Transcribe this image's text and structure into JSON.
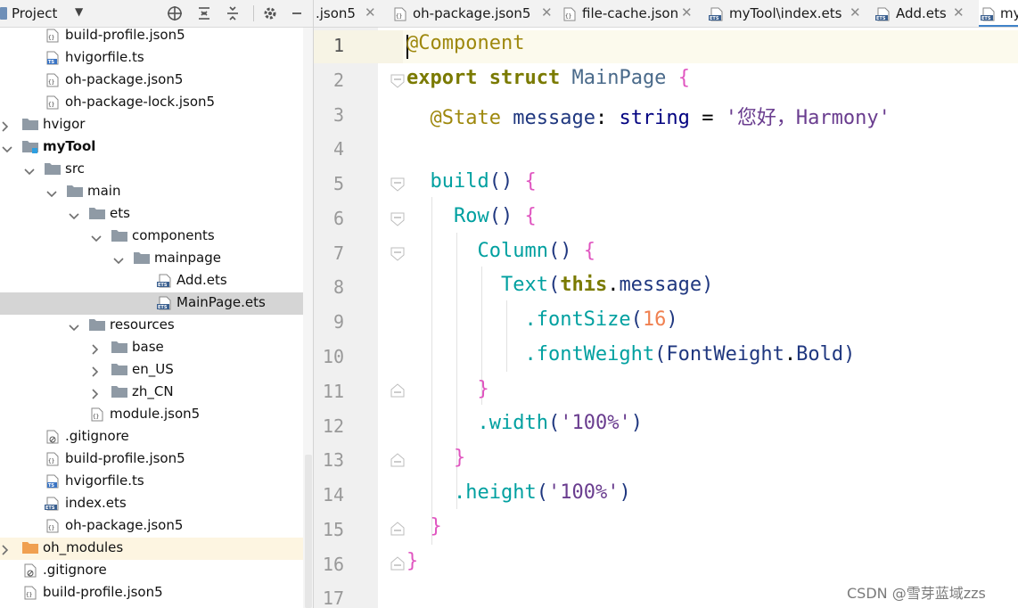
{
  "project_panel": {
    "title": "Project",
    "tree": [
      {
        "label": "build-profile.json5",
        "icon": "json-file-icon"
      },
      {
        "label": "hvigorfile.ts",
        "icon": "ts-file-icon"
      },
      {
        "label": "oh-package.json5",
        "icon": "json-file-icon"
      },
      {
        "label": "oh-package-lock.json5",
        "icon": "json-file-icon"
      },
      {
        "label": "hvigor",
        "icon": "folder-icon"
      },
      {
        "label": "myTool",
        "icon": "module-folder-icon"
      },
      {
        "label": "src",
        "icon": "folder-icon"
      },
      {
        "label": "main",
        "icon": "folder-icon"
      },
      {
        "label": "ets",
        "icon": "folder-icon"
      },
      {
        "label": "components",
        "icon": "folder-icon"
      },
      {
        "label": "mainpage",
        "icon": "folder-icon"
      },
      {
        "label": "Add.ets",
        "icon": "ets-file-icon"
      },
      {
        "label": "MainPage.ets",
        "icon": "ets-file-icon"
      },
      {
        "label": "resources",
        "icon": "folder-icon"
      },
      {
        "label": "base",
        "icon": "folder-icon"
      },
      {
        "label": "en_US",
        "icon": "folder-icon"
      },
      {
        "label": "zh_CN",
        "icon": "folder-icon"
      },
      {
        "label": "module.json5",
        "icon": "json-file-icon"
      },
      {
        "label": ".gitignore",
        "icon": "gitignore-file-icon"
      },
      {
        "label": "build-profile.json5",
        "icon": "json-file-icon"
      },
      {
        "label": "hvigorfile.ts",
        "icon": "ts-file-icon"
      },
      {
        "label": "index.ets",
        "icon": "ets-file-icon"
      },
      {
        "label": "oh-package.json5",
        "icon": "json-file-icon"
      },
      {
        "label": "oh_modules",
        "icon": "orange-folder-icon"
      },
      {
        "label": ".gitignore",
        "icon": "gitignore-file-icon"
      },
      {
        "label": "build-profile.json5",
        "icon": "json-file-icon"
      }
    ]
  },
  "tabs": [
    {
      "label": ".json5"
    },
    {
      "label": "oh-package.json5"
    },
    {
      "label": "file-cache.json"
    },
    {
      "label": "myTool\\index.ets"
    },
    {
      "label": "Add.ets"
    },
    {
      "label": "my"
    }
  ],
  "editor": {
    "line_numbers": [
      "1",
      "2",
      "3",
      "4",
      "5",
      "6",
      "7",
      "8",
      "9",
      "10",
      "11",
      "12",
      "13",
      "14",
      "15",
      "16",
      "17"
    ],
    "code": {
      "l1": "@Component",
      "l2_kw1": "export",
      "l2_kw2": "struct",
      "l2_name": "MainPage",
      "l2_brace": "{",
      "l3_ann": "@State",
      "l3_id": "message",
      "l3_colon": ":",
      "l3_type": "string",
      "l3_eq": "=",
      "l3_str": "'您好，Harmony'",
      "l5_fn": "build",
      "l5_par": "()",
      "l5_brace": "{",
      "l6_fn": "Row",
      "l6_par": "()",
      "l6_brace": "{",
      "l7_fn": "Column",
      "l7_par": "()",
      "l7_brace": "{",
      "l8_fn": "Text",
      "l8_open": "(",
      "l8_this": "this",
      "l8_dot": ".",
      "l8_prop": "message",
      "l8_close": ")",
      "l9_dot": ".",
      "l9_fn": "fontSize",
      "l9_open": "(",
      "l9_num": "16",
      "l9_close": ")",
      "l10_dot": ".",
      "l10_fn": "fontWeight",
      "l10_open": "(",
      "l10_cls": "FontWeight",
      "l10_dot2": ".",
      "l10_prop": "Bold",
      "l10_close": ")",
      "l11_brace": "}",
      "l12_dot": ".",
      "l12_fn": "width",
      "l12_open": "(",
      "l12_str": "'100%'",
      "l12_close": ")",
      "l13_brace": "}",
      "l14_dot": ".",
      "l14_fn": "height",
      "l14_open": "(",
      "l14_str": "'100%'",
      "l14_close": ")",
      "l15_brace": "}",
      "l16_brace": "}"
    }
  },
  "watermark": "CSDN @雪芽蓝域zzs",
  "colors": {
    "selection": "#d5d5d5",
    "tab_active_underline": "#4083c9",
    "gutter": "#f0f0f0",
    "current_line": "#fcfaed"
  }
}
